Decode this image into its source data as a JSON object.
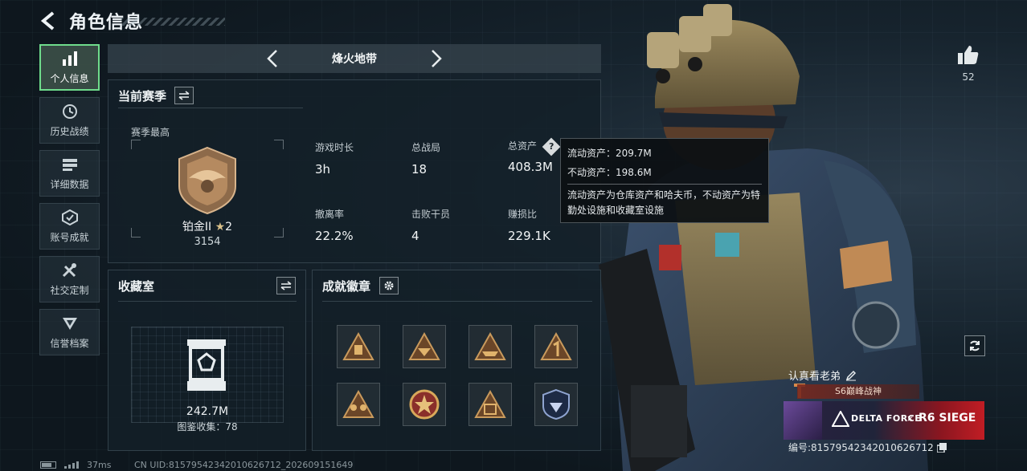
{
  "header": {
    "title": "角色信息"
  },
  "nav": {
    "items": [
      {
        "label": "个人信息",
        "icon": "bar-chart-icon",
        "active": true
      },
      {
        "label": "历史战绩",
        "icon": "history-icon",
        "active": false
      },
      {
        "label": "详细数据",
        "icon": "data-icon",
        "active": false
      },
      {
        "label": "账号成就",
        "icon": "achievement-icon",
        "active": false
      },
      {
        "label": "社交定制",
        "icon": "tools-icon",
        "active": false
      },
      {
        "label": "信誉档案",
        "icon": "credit-icon",
        "active": false
      }
    ]
  },
  "mode": {
    "label": "烽火地带"
  },
  "season": {
    "title": "当前赛季",
    "subtitle": "赛季最高",
    "rank_name": "铂金II",
    "rank_stars": "2",
    "rank_score": "3154",
    "stats": [
      {
        "label": "游戏时长",
        "value": "3h"
      },
      {
        "label": "总战局",
        "value": "18"
      },
      {
        "label": "总资产",
        "value": "408.3M"
      },
      {
        "label": "撤离率",
        "value": "22.2%"
      },
      {
        "label": "击败干员",
        "value": "4"
      },
      {
        "label": "赚损比",
        "value": "229.1K"
      }
    ],
    "help_symbol": "?"
  },
  "tooltip": {
    "liquid": "流动资产：209.7M",
    "fixed": "不动资产：198.6M",
    "description": "流动资产为仓库资产和哈夫币，不动资产为特勤处设施和收藏室设施"
  },
  "collection": {
    "title": "收藏室",
    "value": "242.7M",
    "count": "图鉴收集：78"
  },
  "achievements": {
    "title": "成就徽章",
    "badges": [
      "ammo-badge-icon",
      "s6-badge-icon",
      "boat-badge-icon",
      "number-one-badge-icon",
      "squad-badge-icon",
      "star-medal-badge-icon",
      "crate-badge-icon",
      "shield-badge-icon"
    ]
  },
  "likes": {
    "count": "52"
  },
  "player": {
    "name": "认真看老弟",
    "title_badge": "S6巅峰战神",
    "banner_left": "DELTA FORCE",
    "banner_x": "×",
    "banner_right": "R6 SIEGE",
    "id": "编号:8157954234201062671​2"
  },
  "footer": {
    "ping": "37ms",
    "uid": "CN UID:81579542342010626712_202609151649"
  },
  "colors": {
    "accent": "#6fdc8c",
    "banner_red": "#c11d24"
  }
}
